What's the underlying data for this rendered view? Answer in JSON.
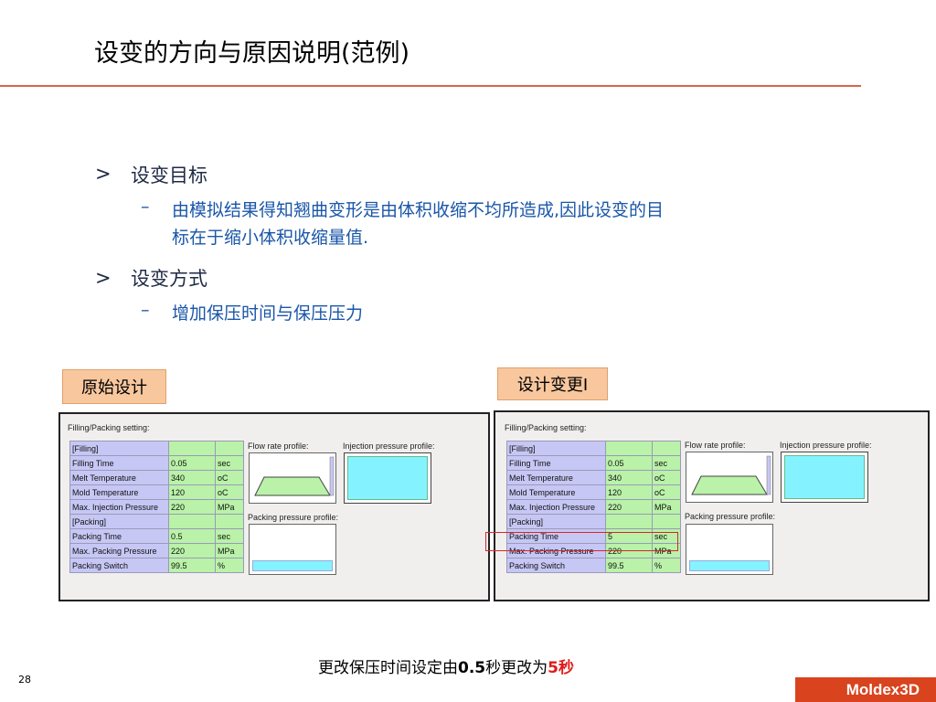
{
  "title": "设变的方向与原因说明(范例)",
  "bullets": [
    {
      "marker": ">",
      "text": "设变目标",
      "sub": {
        "marker": "–",
        "lines": [
          "由模拟结果得知翘曲变形是由体积收缩不均所造成,因此设变的目",
          "标在于缩小体积收缩量值."
        ]
      }
    },
    {
      "marker": ">",
      "text": "设变方式",
      "sub": {
        "marker": "–",
        "lines": [
          "增加保压时间与保压压力"
        ]
      }
    }
  ],
  "labels": {
    "original": "原始设计",
    "changed": "设计变更I"
  },
  "panels": [
    {
      "heading": "Filling/Packing setting:",
      "rows": [
        [
          "[Filling]",
          "",
          ""
        ],
        [
          "Filling Time",
          "0.05",
          "sec"
        ],
        [
          "Melt Temperature",
          "340",
          "oC"
        ],
        [
          "Mold Temperature",
          "120",
          "oC"
        ],
        [
          "Max. Injection Pressure",
          "220",
          "MPa"
        ],
        [
          "[Packing]",
          "",
          ""
        ],
        [
          "Packing Time",
          "0.5",
          "sec"
        ],
        [
          "Max. Packing Pressure",
          "220",
          "MPa"
        ],
        [
          "Packing Switch",
          "99.5",
          "%"
        ]
      ],
      "flow_label": "Flow rate profile:",
      "injection_label": "Injection pressure profile:",
      "packing_label": "Packing pressure profile:"
    },
    {
      "heading": "Filling/Packing setting:",
      "rows": [
        [
          "[Filling]",
          "",
          ""
        ],
        [
          "Filling Time",
          "0.05",
          "sec"
        ],
        [
          "Melt Temperature",
          "340",
          "oC"
        ],
        [
          "Mold Temperature",
          "120",
          "oC"
        ],
        [
          "Max. Injection Pressure",
          "220",
          "MPa"
        ],
        [
          "[Packing]",
          "",
          ""
        ],
        [
          "Packing Time",
          "5",
          "sec"
        ],
        [
          "Max. Packing Pressure",
          "220",
          "MPa"
        ],
        [
          "Packing Switch",
          "99.5",
          "%"
        ]
      ],
      "flow_label": "Flow rate profile:",
      "injection_label": "Injection pressure profile:",
      "packing_label": "Packing pressure profile:"
    }
  ],
  "caption": {
    "part1": "更改保压时间设定由",
    "v1": "0.5",
    "part2": "秒更改为",
    "v2": "5秒"
  },
  "page_number": "28",
  "brand": "Moldex3D",
  "colors": {
    "accent": "#d9431e",
    "bullet_blue": "#1a56a8",
    "tag_fill": "#f8c79e",
    "highlight": "#d8262a"
  }
}
